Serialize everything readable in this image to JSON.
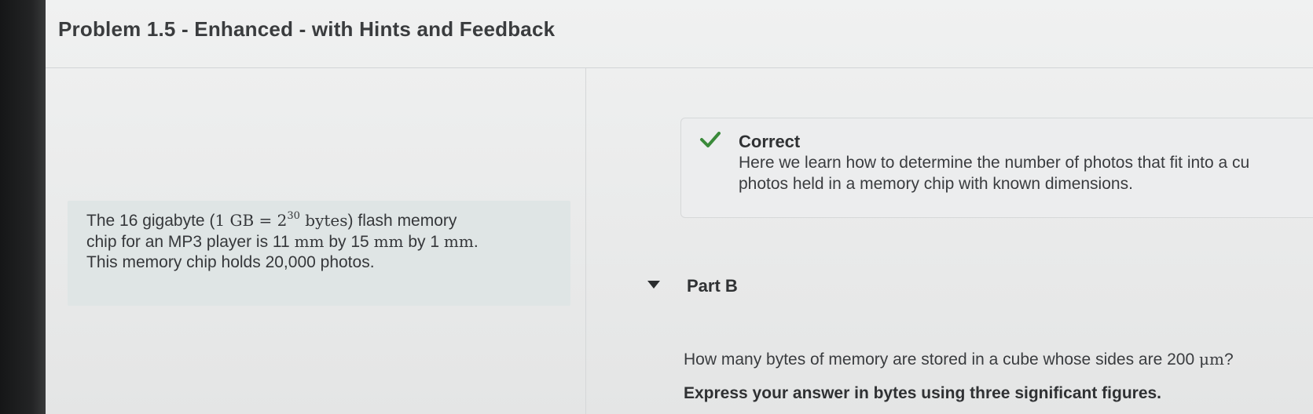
{
  "header": {
    "title": "Problem 1.5 - Enhanced - with Hints and Feedback"
  },
  "problem": {
    "line1_prefix": "The 16 gigabyte (",
    "line1_math_a": "1 GB = 2",
    "line1_exp": "30",
    "line1_math_b": " bytes",
    "line1_suffix": ") flash memory",
    "line2_a": "chip for an MP3 player is 11 ",
    "line2_unit1": "mm",
    "line2_b": " by 15 ",
    "line2_unit2": "mm",
    "line2_c": " by 1 ",
    "line2_unit3": "mm",
    "line2_end": ".",
    "line3": "This memory chip holds 20,000 photos."
  },
  "feedback": {
    "status_label": "Correct",
    "status_color": "#3a8a3a",
    "status_icon": "checkmark-icon",
    "line1": "Here we learn how to determine the number of photos that fit into a cu",
    "line2": "photos held in a memory chip with known dimensions."
  },
  "part": {
    "toggle_icon": "caret-down-icon",
    "label": "Part B",
    "question_prefix": "How many bytes of memory are stored in a cube whose sides are 200 ",
    "question_unit": "μm",
    "question_suffix": "?",
    "instruction": "Express your answer in bytes using three significant figures."
  }
}
